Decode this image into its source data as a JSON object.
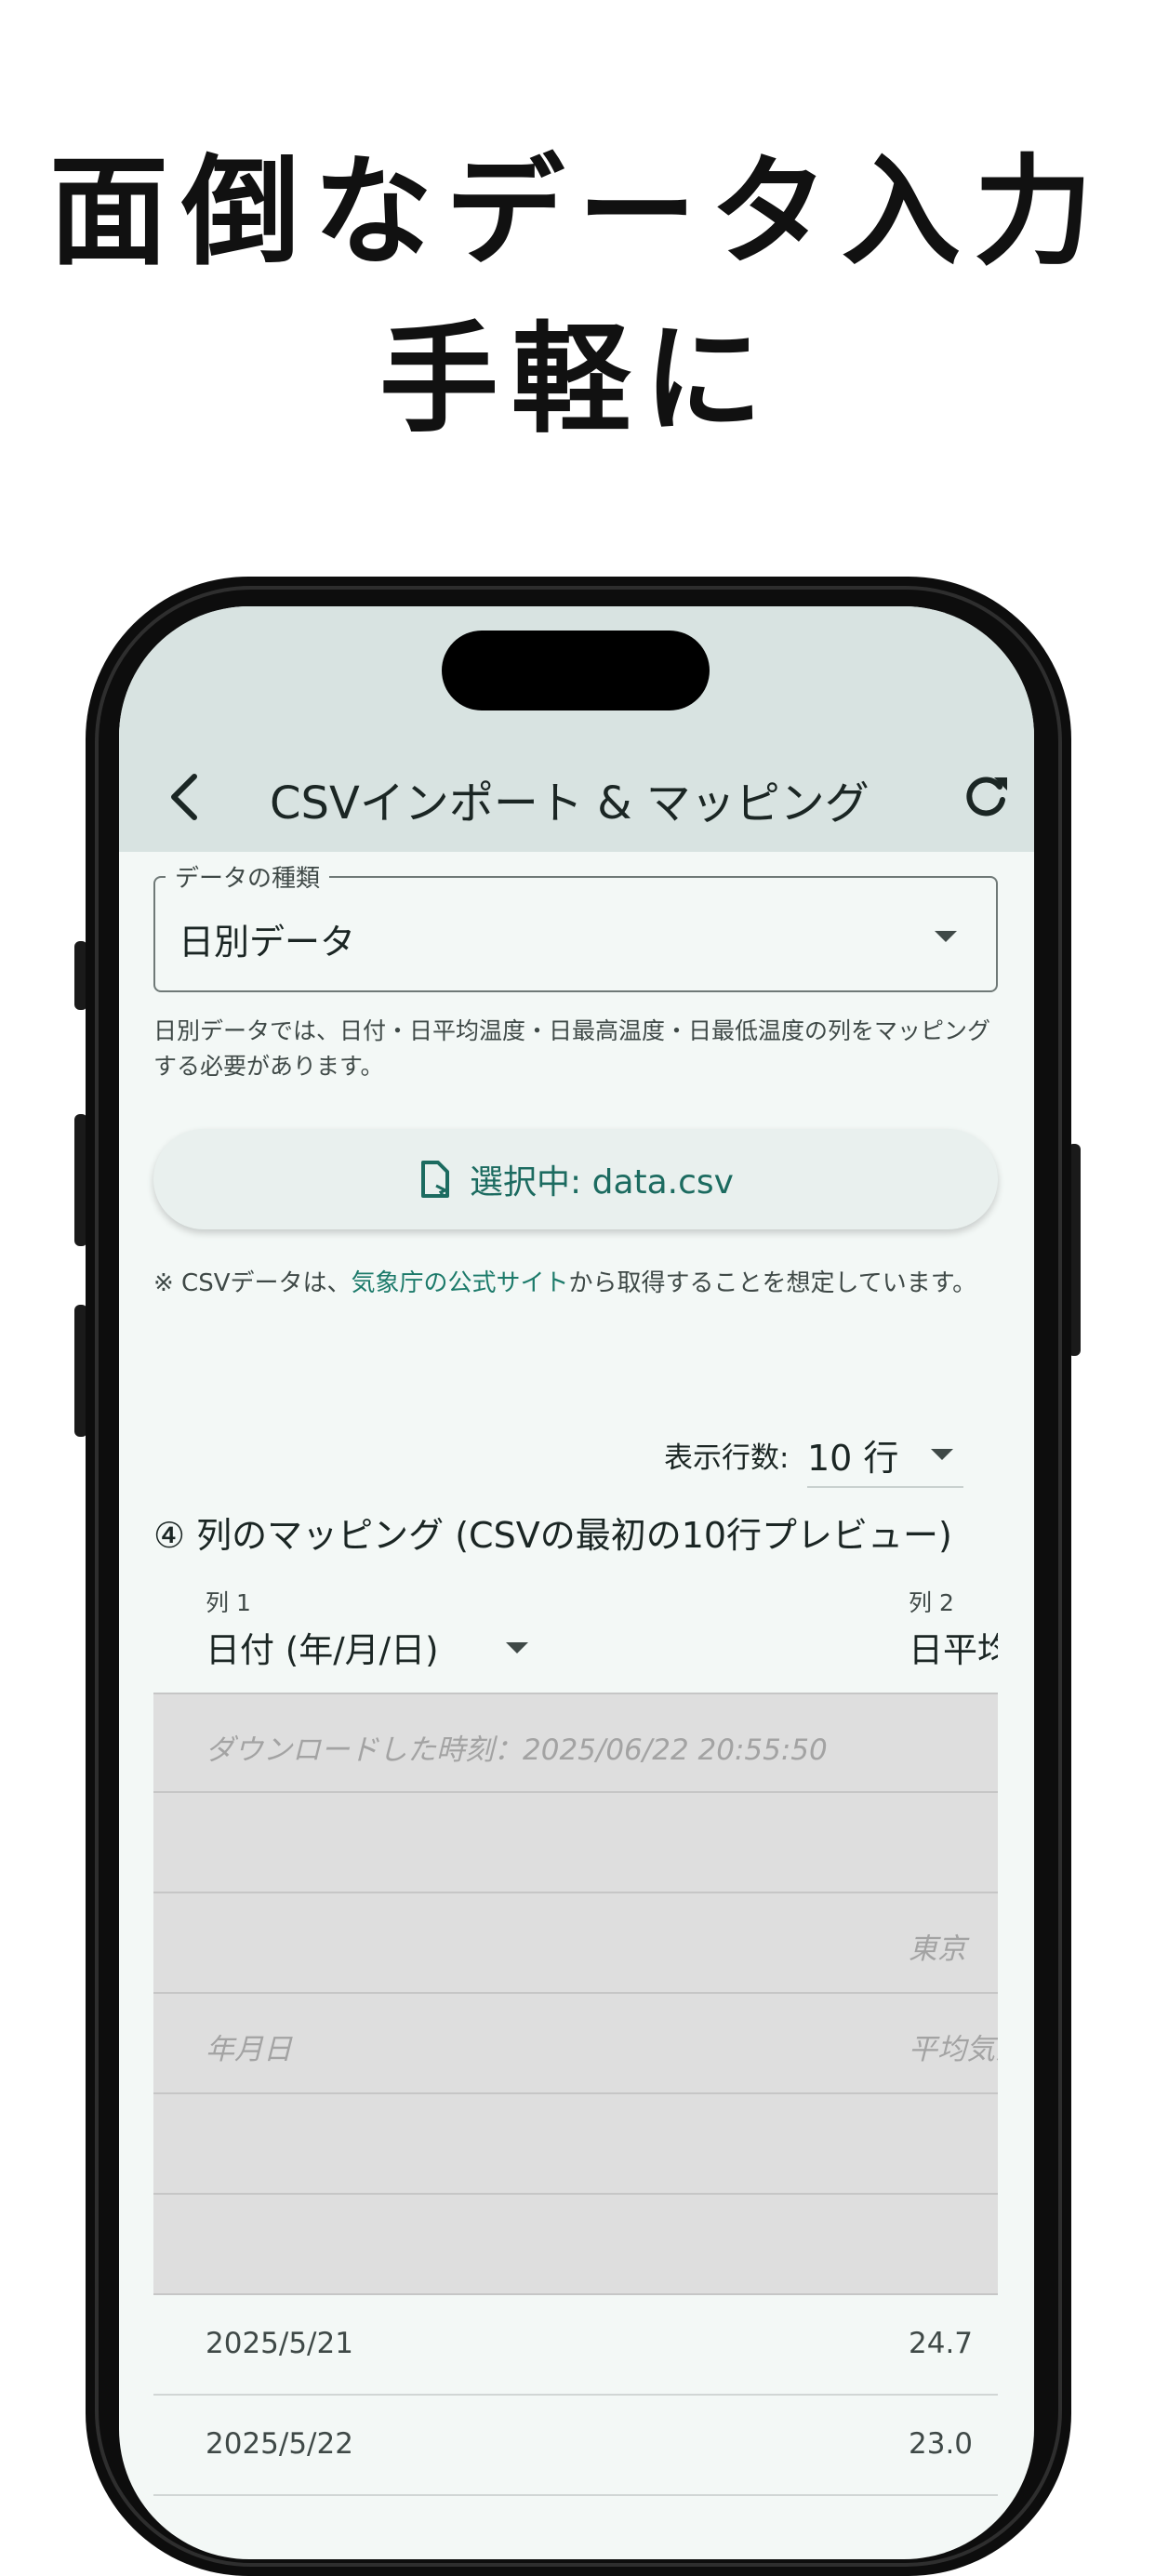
{
  "headline": {
    "line1": "面倒なデータ入力",
    "line2": "手軽に"
  },
  "appbar": {
    "title": "CSVインポート & マッピング",
    "back_icon": "chevron-left-icon",
    "refresh_icon": "refresh-icon"
  },
  "data_type": {
    "label": "データの種類",
    "value": "日別データ",
    "helper": "日別データでは、日付・日平均温度・日最高温度・日最低温度の列をマッピングする必要があります。"
  },
  "file_button": {
    "label": "選択中: data.csv",
    "icon": "file-icon"
  },
  "note": {
    "prefix": "※ CSVデータは、",
    "link": "気象庁の公式サイト",
    "suffix": "から取得することを想定しています。"
  },
  "rows": {
    "label": "表示行数:",
    "value": "10 行"
  },
  "mapping": {
    "title": "④ 列のマッピング (CSVの最初の10行プレビュー)",
    "columns": [
      {
        "header": "列 1",
        "mapping": "日付 (年/月/日)"
      },
      {
        "header": "列 2",
        "mapping": "日平均気温"
      }
    ]
  },
  "preview": {
    "meta_rows": [
      [
        "ダウンロードした時刻：2025/06/22 20:55:50",
        ""
      ],
      [
        "",
        ""
      ],
      [
        "",
        "東京"
      ],
      [
        "年月日",
        "平均気温"
      ],
      [
        "",
        ""
      ],
      [
        "",
        ""
      ]
    ],
    "data_rows": [
      [
        "2025/5/21",
        "24.7"
      ],
      [
        "2025/5/22",
        "23.0"
      ]
    ]
  },
  "colors": {
    "accent": "#1c6b60",
    "appbar_bg": "#d8e3e1",
    "screen_bg": "#f3f8f6",
    "meta_row_bg": "#dedede"
  }
}
